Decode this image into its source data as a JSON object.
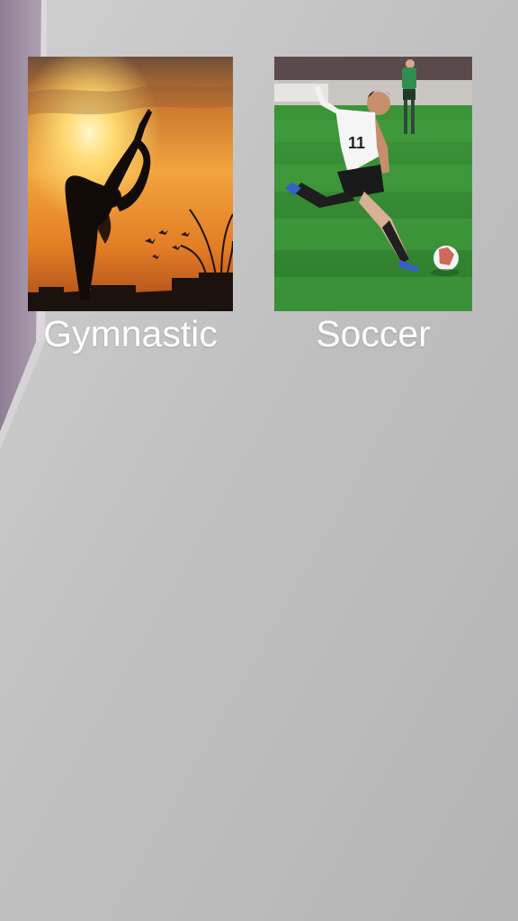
{
  "sports": [
    {
      "label": "Gymnastic",
      "image": "gymnast-sunset-silhouette"
    },
    {
      "label": "Soccer",
      "image": "soccer-player-kicking-ball"
    }
  ],
  "colors": {
    "label_text": "#ffffff",
    "wall": "#bdbdbe",
    "side_wall": "#9f8ea3"
  }
}
